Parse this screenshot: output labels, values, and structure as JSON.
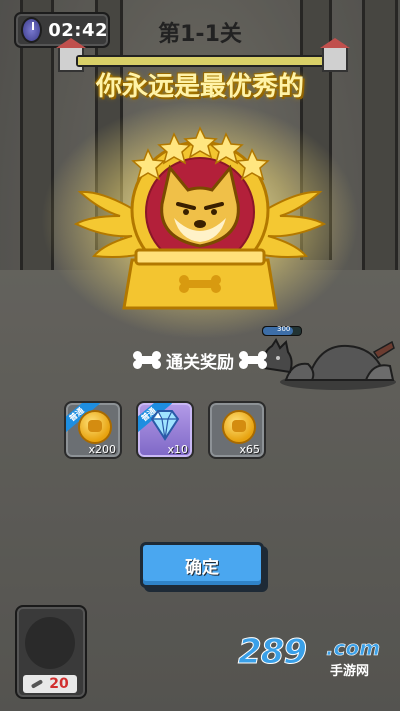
{
  "hud": {
    "timer": "02:42",
    "stage": "第1-1关",
    "progress": 1.0
  },
  "headline": "你永远是最优秀的",
  "enemy": {
    "hp": "300"
  },
  "rewards": {
    "title": "通关奖励",
    "items": [
      {
        "tag": "普通",
        "type": "coin-icon",
        "quantity": "x200"
      },
      {
        "tag": "普通",
        "type": "diamond-icon",
        "quantity": "x10"
      },
      {
        "tag": "",
        "type": "coin-icon",
        "quantity": "x65"
      }
    ]
  },
  "confirm_label": "确定",
  "character_card": {
    "cost": "20"
  },
  "watermark": {
    "number": "289",
    "domain": ".com",
    "sub": "手游网"
  },
  "colors": {
    "accent_blue": "#4aa7f0",
    "gold": "#f3c530",
    "text_glow": "#fff3a8"
  }
}
